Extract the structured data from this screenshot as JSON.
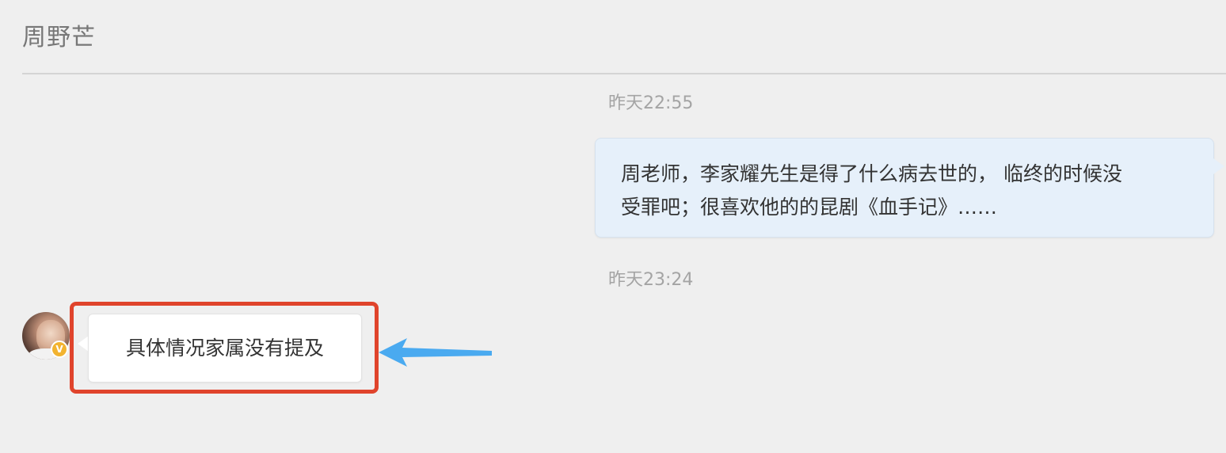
{
  "header": {
    "title": "周野芒"
  },
  "conversation": {
    "messages": [
      {
        "timestamp": "昨天22:55",
        "direction": "outgoing",
        "lines": [
          "周老师，李家耀先生是得了什么病去世的， 临终的时候没",
          "受罪吧；很喜欢他的的昆剧《血手记》……"
        ]
      },
      {
        "timestamp": "昨天23:24",
        "direction": "incoming",
        "text": "具体情况家属没有提及",
        "badge": "V"
      }
    ]
  },
  "annotation": {
    "highlight_color": "#e0442c",
    "arrow_color": "#4aaaf0"
  },
  "colors": {
    "background": "#efefef",
    "outgoing_bubble": "#e6f0fa",
    "incoming_bubble": "#ffffff",
    "timestamp_text": "#a4a4a4",
    "verified_badge": "#f2b330"
  }
}
